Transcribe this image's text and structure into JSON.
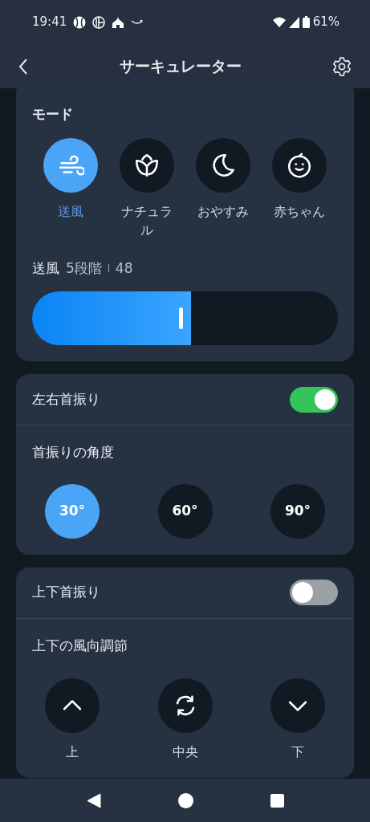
{
  "status_bar": {
    "time": "19:41",
    "battery": "61%"
  },
  "app_bar": {
    "title": "サーキュレーター"
  },
  "mode_card": {
    "title": "モード",
    "modes": [
      {
        "label": "送風",
        "kind": "wind",
        "selected": true
      },
      {
        "label": "ナチュラル",
        "kind": "leaf",
        "selected": false
      },
      {
        "label": "おやすみ",
        "kind": "moon",
        "selected": false
      },
      {
        "label": "赤ちゃん",
        "kind": "baby",
        "selected": false
      }
    ],
    "speed": {
      "label": "送風",
      "steps": "5段階",
      "value": "48",
      "level": 0.52
    }
  },
  "horizontal_swing_card": {
    "label": "左右首振り",
    "on": true,
    "subtitle": "首振りの角度",
    "angles": [
      {
        "label": "30°",
        "selected": true
      },
      {
        "label": "60°",
        "selected": false
      },
      {
        "label": "90°",
        "selected": false
      }
    ]
  },
  "vertical_swing_card": {
    "label": "上下首振り",
    "on": false,
    "subtitle": "上下の風向調節",
    "directions": [
      {
        "label": "上",
        "kind": "up"
      },
      {
        "label": "中央",
        "kind": "center"
      },
      {
        "label": "下",
        "kind": "down"
      }
    ]
  }
}
